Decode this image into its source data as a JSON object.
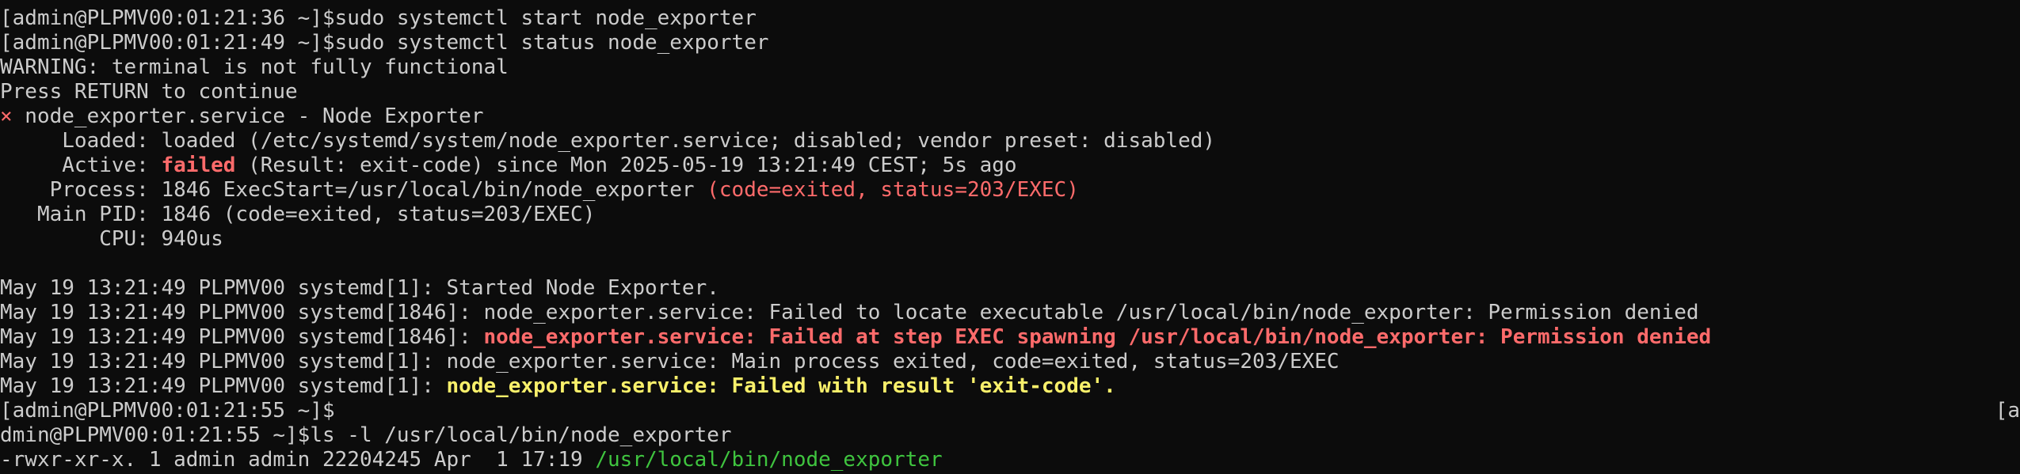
{
  "terminal": {
    "lines": [
      [
        {
          "text": "[admin@PLPMV00:01:21:36 ~]$sudo systemctl start node_exporter"
        }
      ],
      [
        {
          "text": "[admin@PLPMV00:01:21:49 ~]$sudo systemctl status node_exporter"
        }
      ],
      [
        {
          "text": "WARNING: terminal is not fully functional"
        }
      ],
      [
        {
          "text": "Press RETURN to continue"
        }
      ],
      [
        {
          "text": "×",
          "style": "red"
        },
        {
          "text": " node_exporter.service - Node Exporter"
        }
      ],
      [
        {
          "text": "     Loaded: loaded (/etc/systemd/system/node_exporter.service; disabled; vendor preset: disabled)"
        }
      ],
      [
        {
          "text": "     Active: "
        },
        {
          "text": "failed",
          "style": "red-bold"
        },
        {
          "text": " (Result: exit-code) since Mon 2025-05-19 13:21:49 CEST; 5s ago"
        }
      ],
      [
        {
          "text": "    Process: 1846 ExecStart=/usr/local/bin/node_exporter "
        },
        {
          "text": "(code=exited, status=203/EXEC)",
          "style": "red"
        }
      ],
      [
        {
          "text": "   Main PID: 1846 (code=exited, status=203/EXEC)"
        }
      ],
      [
        {
          "text": "        CPU: 940us"
        }
      ],
      [
        {
          "text": ""
        }
      ],
      [
        {
          "text": "May 19 13:21:49 PLPMV00 systemd[1]: Started Node Exporter."
        }
      ],
      [
        {
          "text": "May 19 13:21:49 PLPMV00 systemd[1846]: node_exporter.service: Failed to locate executable /usr/local/bin/node_exporter: Permission denied"
        }
      ],
      [
        {
          "text": "May 19 13:21:49 PLPMV00 systemd[1846]: "
        },
        {
          "text": "node_exporter.service: Failed at step EXEC spawning /usr/local/bin/node_exporter: Permission denied",
          "style": "red-bold"
        }
      ],
      [
        {
          "text": "May 19 13:21:49 PLPMV00 systemd[1]: node_exporter.service: Main process exited, code=exited, status=203/EXEC"
        }
      ],
      [
        {
          "text": "May 19 13:21:49 PLPMV00 systemd[1]: "
        },
        {
          "text": "node_exporter.service: Failed with result 'exit-code'.",
          "style": "yellow-bold"
        }
      ],
      [
        {
          "text": "[admin@PLPMV00:01:21:55 ~]$"
        }
      ],
      [
        {
          "text": "dmin@PLPMV00:01:21:55 ~]$ls -l /usr/local/bin/node_exporter"
        }
      ],
      [
        {
          "text": "-rwxr-xr-x. 1 admin admin 22204245 Apr  1 17:19 "
        },
        {
          "text": "/usr/local/bin/node_exporter",
          "style": "green"
        }
      ]
    ],
    "wrap_marker": "[a",
    "colors": {
      "background": "#0c0c0c",
      "foreground": "#cccccc",
      "red": "#ff6b6b",
      "yellow": "#f9f06b",
      "green": "#3fc43f"
    }
  }
}
